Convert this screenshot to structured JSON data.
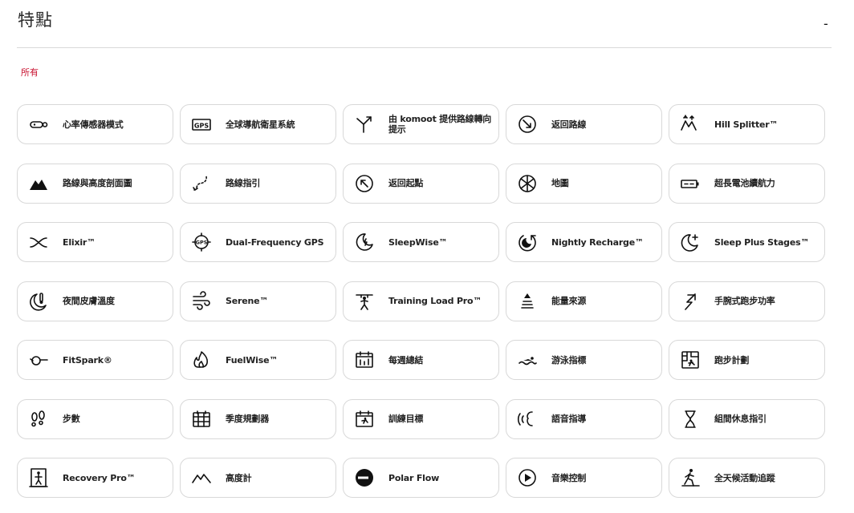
{
  "header": {
    "title": "特點",
    "collapse_symbol": "-"
  },
  "filter": {
    "active_label": "所有"
  },
  "features": [
    {
      "label": "心率傳感器模式",
      "icon": "heart-sensor-icon"
    },
    {
      "label": "全球導航衛星系統",
      "icon": "gps-icon"
    },
    {
      "label": "由 komoot 提供路線轉向提示",
      "icon": "komoot-turn-icon"
    },
    {
      "label": "返回路線",
      "icon": "back-to-route-icon"
    },
    {
      "label": "Hill Splitter™",
      "icon": "hill-splitter-icon"
    },
    {
      "label": "路線與高度剖面圖",
      "icon": "route-profile-icon"
    },
    {
      "label": "路線指引",
      "icon": "route-guidance-icon"
    },
    {
      "label": "返回起點",
      "icon": "back-to-start-icon"
    },
    {
      "label": "地圖",
      "icon": "map-icon"
    },
    {
      "label": "超長電池續航力",
      "icon": "battery-icon"
    },
    {
      "label": "Elixir™",
      "icon": "elixir-icon"
    },
    {
      "label": "Dual-Frequency GPS",
      "icon": "dual-frequency-gps-icon"
    },
    {
      "label": "SleepWise™",
      "icon": "sleepwise-icon"
    },
    {
      "label": "Nightly Recharge™",
      "icon": "nightly-recharge-icon"
    },
    {
      "label": "Sleep Plus Stages™",
      "icon": "sleep-plus-icon"
    },
    {
      "label": "夜間皮膚溫度",
      "icon": "night-skin-temp-icon"
    },
    {
      "label": "Serene™",
      "icon": "serene-icon"
    },
    {
      "label": "Training Load Pro™",
      "icon": "training-load-icon"
    },
    {
      "label": "能量來源",
      "icon": "energy-sources-icon"
    },
    {
      "label": "手腕式跑步功率",
      "icon": "running-power-icon"
    },
    {
      "label": "FitSpark®",
      "icon": "fitspark-icon"
    },
    {
      "label": "FuelWise™",
      "icon": "fuelwise-icon"
    },
    {
      "label": "每週總結",
      "icon": "weekly-summary-icon"
    },
    {
      "label": "游泳指標",
      "icon": "swimming-icon"
    },
    {
      "label": "跑步計劃",
      "icon": "running-program-icon"
    },
    {
      "label": "步數",
      "icon": "steps-icon"
    },
    {
      "label": "季度規劃器",
      "icon": "season-planner-icon"
    },
    {
      "label": "訓練目標",
      "icon": "training-target-icon"
    },
    {
      "label": "語音指導",
      "icon": "voice-guidance-icon"
    },
    {
      "label": "組間休息指引",
      "icon": "rest-timer-icon"
    },
    {
      "label": "Recovery Pro™",
      "icon": "recovery-pro-icon"
    },
    {
      "label": "高度計",
      "icon": "altimeter-icon"
    },
    {
      "label": "Polar Flow",
      "icon": "polar-flow-icon"
    },
    {
      "label": "音樂控制",
      "icon": "music-control-icon"
    },
    {
      "label": "全天候活動追蹤",
      "icon": "activity-tracking-icon"
    }
  ]
}
